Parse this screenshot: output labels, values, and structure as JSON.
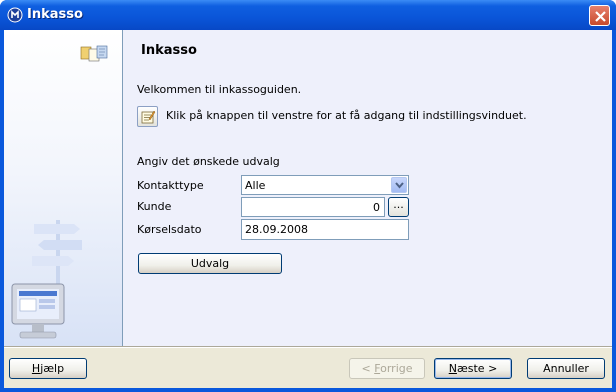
{
  "window": {
    "title": "Inkasso"
  },
  "page": {
    "title": "Inkasso",
    "welcome": "Velkommen til inkassoguiden.",
    "hint": "Klik på knappen til venstre for at få adgang til indstillingsvinduet.",
    "section_label": "Angiv det ønskede udvalg"
  },
  "form": {
    "kontakttype": {
      "label": "Kontakttype",
      "value": "Alle"
    },
    "kunde": {
      "label": "Kunde",
      "value": "0",
      "lookup": "..."
    },
    "korselsdato": {
      "label": "Kørselsdato",
      "value": "28.09.2008"
    },
    "udvalg_button": "Udvalg"
  },
  "buttons": {
    "help": {
      "mnemonic": "H",
      "rest": "jælp"
    },
    "back": {
      "prefix": "< ",
      "mnemonic": "F",
      "rest": "orrige"
    },
    "next": {
      "mnemonic": "N",
      "rest": "æste >"
    },
    "cancel": {
      "label": "Annuller"
    }
  },
  "colors": {
    "titlebar": "#0a55d8",
    "panel": "#eef0fb",
    "dialog": "#ece9d8"
  },
  "icons": [
    "app-icon",
    "close-icon",
    "settings-icon",
    "dropdown-arrow-icon",
    "wizard-logo-icon",
    "signpost-illustration",
    "monitor-illustration"
  ]
}
